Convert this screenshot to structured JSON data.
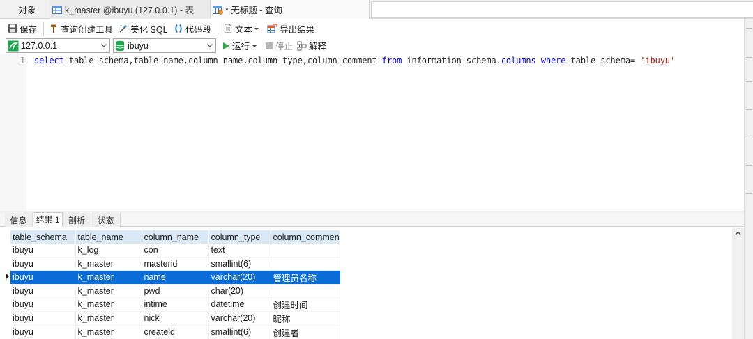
{
  "tabs": {
    "objects": "对象",
    "table_tab": "k_master @ibuyu (127.0.0.1) - 表",
    "query_tab": "* 无标题 - 查询"
  },
  "toolbar": {
    "save": "保存",
    "query_builder": "查询创建工具",
    "beautify": "美化 SQL",
    "snippet": "代码段",
    "text": "文本",
    "export": "导出结果"
  },
  "connbar": {
    "connection": "127.0.0.1",
    "database": "ibuyu",
    "run": "运行",
    "stop": "停止",
    "explain": "解释"
  },
  "editor": {
    "line_number": "1",
    "sql": {
      "kw1": "select",
      "fields": " table_schema,table_name,column_name,column_type,column_comment ",
      "kw2": "from",
      "schema": " information_schema.",
      "kw3": "columns",
      "sp": " ",
      "kw4": "where",
      "cond": " table_schema= ",
      "str": "'ibuyu'"
    }
  },
  "result_tabs": [
    "信息",
    "结果 1",
    "剖析",
    "状态"
  ],
  "grid": {
    "columns": [
      "table_schema",
      "table_name",
      "column_name",
      "column_type",
      "column_commen"
    ],
    "rows": [
      [
        "ibuyu",
        "k_log",
        "con",
        "text",
        ""
      ],
      [
        "ibuyu",
        "k_master",
        "masterid",
        "smallint(6)",
        ""
      ],
      [
        "ibuyu",
        "k_master",
        "name",
        "varchar(20)",
        "管理员名称"
      ],
      [
        "ibuyu",
        "k_master",
        "pwd",
        "char(20)",
        ""
      ],
      [
        "ibuyu",
        "k_master",
        "intime",
        "datetime",
        "创建时间"
      ],
      [
        "ibuyu",
        "k_master",
        "nick",
        "varchar(20)",
        "昵称"
      ],
      [
        "ibuyu",
        "k_master",
        "createid",
        "smallint(6)",
        "创建者"
      ]
    ],
    "selected_row": 2
  },
  "colors": {
    "keyword": "#0000ff",
    "string": "#b5140e",
    "selection": "#0a6cd6",
    "header": "#dbe9f7"
  }
}
